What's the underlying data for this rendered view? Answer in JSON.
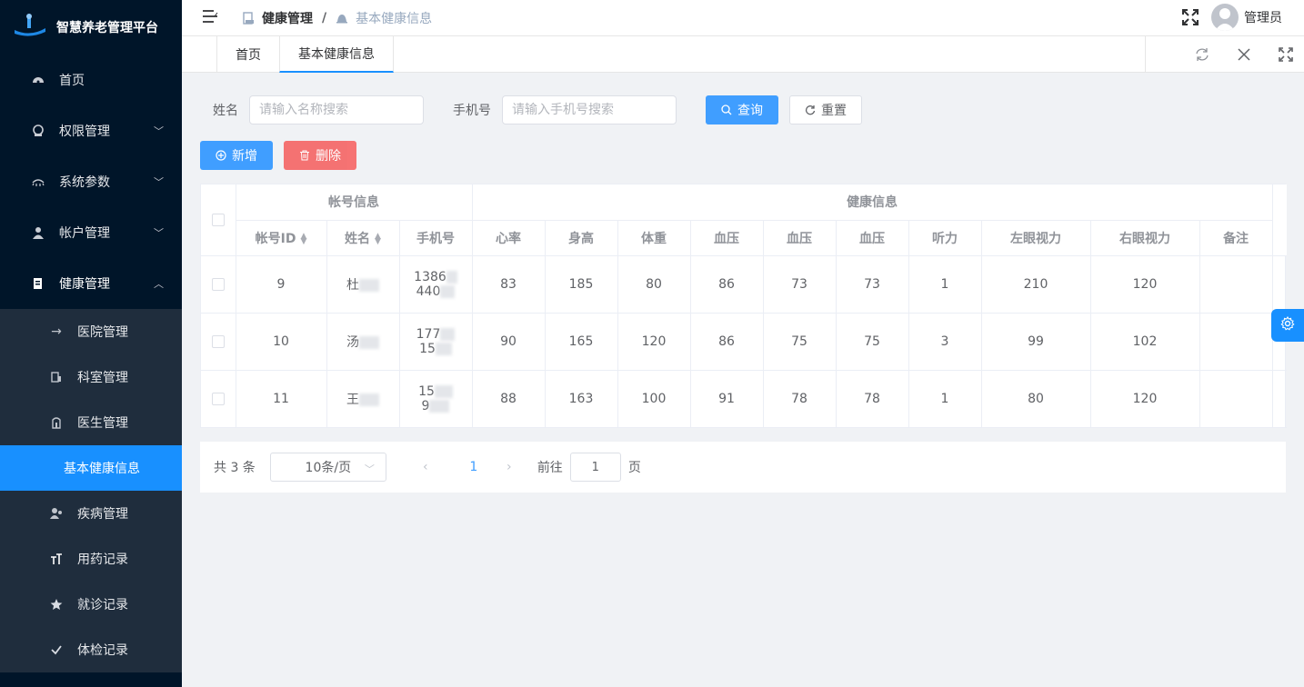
{
  "app": {
    "title": "智慧养老管理平台"
  },
  "sidebar": {
    "items": [
      {
        "label": "首页",
        "icon": "dashboard-icon"
      },
      {
        "label": "权限管理",
        "icon": "permission-icon"
      },
      {
        "label": "系统参数",
        "icon": "params-icon"
      },
      {
        "label": "帐户管理",
        "icon": "user-icon"
      },
      {
        "label": "健康管理",
        "icon": "health-icon"
      }
    ],
    "submenu": [
      {
        "label": "医院管理",
        "icon": "arrow-icon"
      },
      {
        "label": "科室管理",
        "icon": "department-icon"
      },
      {
        "label": "医生管理",
        "icon": "doctor-icon"
      },
      {
        "label": "基本健康信息",
        "icon": ""
      },
      {
        "label": "疾病管理",
        "icon": "disease-icon"
      },
      {
        "label": "用药记录",
        "icon": "text-size-icon"
      },
      {
        "label": "就诊记录",
        "icon": "star-icon"
      },
      {
        "label": "体检记录",
        "icon": "check-icon"
      }
    ]
  },
  "navbar": {
    "breadcrumb": [
      "健康管理",
      "基本健康信息"
    ],
    "breadcrumb_sep": "/",
    "user_name": "管理员"
  },
  "tags": {
    "items": [
      "首页",
      "基本健康信息"
    ]
  },
  "search": {
    "name_label": "姓名",
    "name_placeholder": "请输入名称搜索",
    "phone_label": "手机号",
    "phone_placeholder": "请输入手机号搜索",
    "query_label": "查询",
    "reset_label": "重置"
  },
  "toolbar": {
    "add_label": "新增",
    "delete_label": "删除"
  },
  "table": {
    "group_headers": [
      "帐号信息",
      "健康信息"
    ],
    "columns": [
      "帐号ID",
      "姓名",
      "手机号",
      "心率",
      "身高",
      "体重",
      "血压",
      "血压",
      "血压",
      "听力",
      "左眼视力",
      "右眼视力",
      "备注"
    ],
    "rows": [
      {
        "id": "9",
        "name": "杜",
        "phone1": "1386",
        "phone2": "440",
        "heart": "83",
        "height": "185",
        "weight": "80",
        "bp1": "86",
        "bp2": "73",
        "bp3": "73",
        "hearing": "1",
        "left": "210",
        "right": "120",
        "note": ""
      },
      {
        "id": "10",
        "name": "汤",
        "phone1": "177",
        "phone2": "15",
        "heart": "90",
        "height": "165",
        "weight": "120",
        "bp1": "86",
        "bp2": "75",
        "bp3": "75",
        "hearing": "3",
        "left": "99",
        "right": "102",
        "note": ""
      },
      {
        "id": "11",
        "name": "王",
        "phone1": "15",
        "phone2": "9",
        "heart": "88",
        "height": "163",
        "weight": "100",
        "bp1": "91",
        "bp2": "78",
        "bp3": "78",
        "hearing": "1",
        "left": "80",
        "right": "120",
        "note": ""
      }
    ]
  },
  "pagination": {
    "total_text": "共 3 条",
    "page_size": "10条/页",
    "current": "1",
    "goto_label": "前往",
    "goto_value": "1",
    "page_suffix": "页"
  },
  "colors": {
    "primary": "#409eff",
    "danger": "#f56c6c",
    "sidebar_bg": "#001529",
    "active_menu": "#1890ff"
  }
}
